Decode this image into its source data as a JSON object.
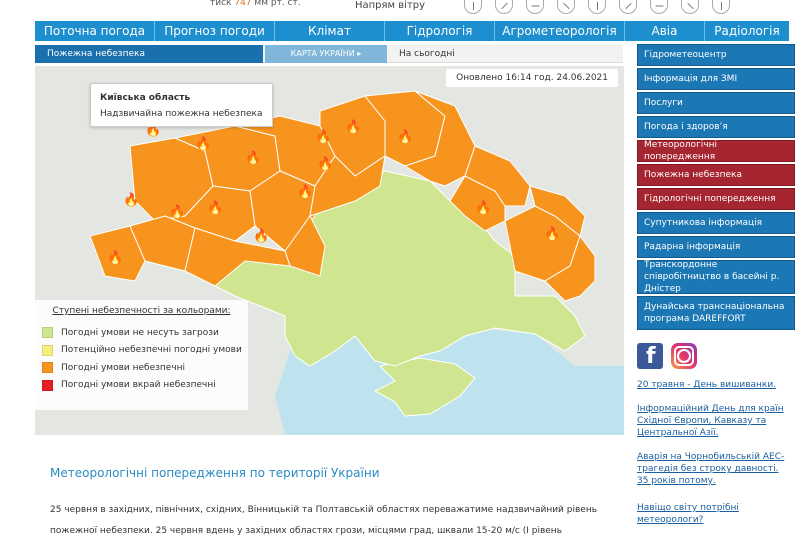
{
  "top": {
    "pressure_label": "тиск",
    "pressure_value": "747",
    "pressure_unit": "мм рт. ст.",
    "wind_label": "Напрям вітру",
    "wind_icons": [
      "wind-n-icon",
      "wind-ne-icon",
      "wind-e-icon",
      "wind-se-icon",
      "wind-s-icon",
      "wind-sw-icon",
      "wind-w-icon",
      "wind-nw-icon",
      "wind-calm-icon"
    ]
  },
  "nav": {
    "items": [
      "Поточна погода",
      "Прогноз погоди",
      "Клімат",
      "Гідрологія",
      "Агрометеорологія",
      "Авіа",
      "Радіологія"
    ]
  },
  "subnav": {
    "fire": "Пожежна небезпека",
    "map": "КАРТА УКРАЇНИ ▸",
    "today": "На сьогодні"
  },
  "map": {
    "updated": "Оновлено 16:14 год. 24.06.2021",
    "tooltip_region": "Київська область",
    "tooltip_status": "Надзвичайна пожежна небезпека",
    "legend_title": "Ступені небезпечності за кольорами:",
    "legend": [
      {
        "label": "Погодні умови не несуть загрози",
        "color": "#cfe590"
      },
      {
        "label": "Потенційно небезпечні погодні умови",
        "color": "#f5ee7a"
      },
      {
        "label": "Погодні умови небезпечні",
        "color": "#f7941e"
      },
      {
        "label": "Погодні умови вкрай небезпечні",
        "color": "#e31e25"
      }
    ],
    "colors": {
      "safe": "#cfe590",
      "danger": "#f7941e",
      "sea": "#bfe3ee",
      "land": "#e4e6e2"
    }
  },
  "sidebar": {
    "items": [
      {
        "label": "Гідрометеоцентр",
        "red": false
      },
      {
        "label": "Інформація для ЗМІ",
        "red": false
      },
      {
        "label": "Послуги",
        "red": false
      },
      {
        "label": "Погода і здоров’я",
        "red": false
      },
      {
        "label": "Метеорологічні попередження",
        "red": true
      },
      {
        "label": "Пожежна небезпека",
        "red": true
      },
      {
        "label": "Гідрологічні попередження",
        "red": true
      },
      {
        "label": "Супутникова інформація",
        "red": false
      },
      {
        "label": "Радарна інформація",
        "red": false
      },
      {
        "label": "Транскордонне співробітництво в басейні р. Дністер",
        "red": false
      },
      {
        "label": "Дунайська транснаціональна програма DAREFFORT",
        "red": false
      }
    ]
  },
  "news": [
    "20 травня - День вишиванки.",
    "Інформаційний День для країн Східної Європи, Кавказу та Центральної Азії.",
    "Аварія на Чорнобильській АЕС-трагедія без строку давності. 35 років потому.",
    "Навіщо світу потрібні метеорологи?"
  ],
  "warnings": {
    "title": "Метеорологічні попередження по території України",
    "text": "25 червня в західних, північних, східних, Вінницькій та Полтавській областях переважатиме надзвичайний рівень пожежної небезпеки. 25 червня вдень у західних областях грози, місцями град, шквали 15-20 м/с (І рівень небезпечності, жовтий)."
  }
}
